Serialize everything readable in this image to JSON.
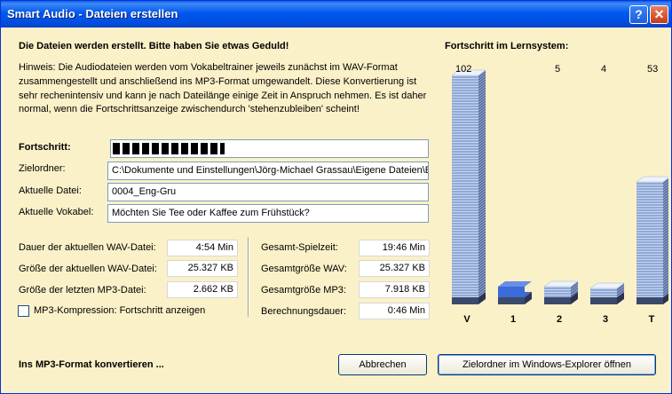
{
  "window": {
    "title": "Smart Audio - Dateien erstellen",
    "help_glyph": "?",
    "close_glyph": "✕"
  },
  "heading": "Die Dateien werden erstellt. Bitte haben Sie etwas Geduld!",
  "hint": "Hinweis: Die Audiodateien werden vom Vokabeltrainer jeweils zunächst im WAV-Format zusammengestellt und anschließend ins MP3-Format umgewandelt. Diese Konvertierung ist sehr rechenintensiv und kann je nach Dateilänge einige Zeit in Anspruch nehmen. Es ist daher normal, wenn die Fortschrittsanzeige zwischendurch 'stehenzubleiben' scheint!",
  "progress": {
    "label": "Fortschritt:",
    "fraction": 0.36,
    "color": "#000000"
  },
  "fields": {
    "target_label": "Zielordner:",
    "target_value": "C:\\Dokumente und Einstellungen\\Jörg-Michael Grassau\\Eigene Dateien\\Eigene",
    "current_file_label": "Aktuelle Datei:",
    "current_file_value": "0004_Eng-Gru",
    "current_vocab_label": "Aktuelle Vokabel:",
    "current_vocab_value": "Möchten Sie Tee oder Kaffee zum Frühstück?"
  },
  "stats_left": [
    {
      "label": "Dauer der aktuellen WAV-Datei:",
      "value": "4:54 Min"
    },
    {
      "label": "Größe der aktuellen WAV-Datei:",
      "value": "25.327 KB"
    },
    {
      "label": "Größe der letzten MP3-Datei:",
      "value": "2.662 KB"
    }
  ],
  "stats_right": [
    {
      "label": "Gesamt-Spielzeit:",
      "value": "19:46 Min"
    },
    {
      "label": "Gesamtgröße WAV:",
      "value": "25.327 KB"
    },
    {
      "label": "Gesamtgröße MP3:",
      "value": "7.918 KB"
    },
    {
      "label": "Berechnungsdauer:",
      "value": "0:46 Min"
    }
  ],
  "checkbox": {
    "label": "MP3-Kompression: Fortschritt anzeigen",
    "checked": false
  },
  "status": "Ins MP3-Format konvertieren ...",
  "buttons": {
    "cancel": "Abbrechen",
    "open_folder": "Zielordner im Windows-Explorer öffnen"
  },
  "chart_data": {
    "type": "bar",
    "title": "Fortschritt im Lernsystem:",
    "categories": [
      "V",
      "1",
      "2",
      "3",
      "T"
    ],
    "value_labels": [
      "102",
      "",
      "5",
      "4",
      "53"
    ],
    "values": [
      102,
      0,
      5,
      4,
      53
    ],
    "colors": {
      "bar_face": "#c6d6f0",
      "bar_line": "#5c7cbc",
      "empty_bar": "#3c6ad8",
      "base": "#3a4a6a"
    }
  }
}
